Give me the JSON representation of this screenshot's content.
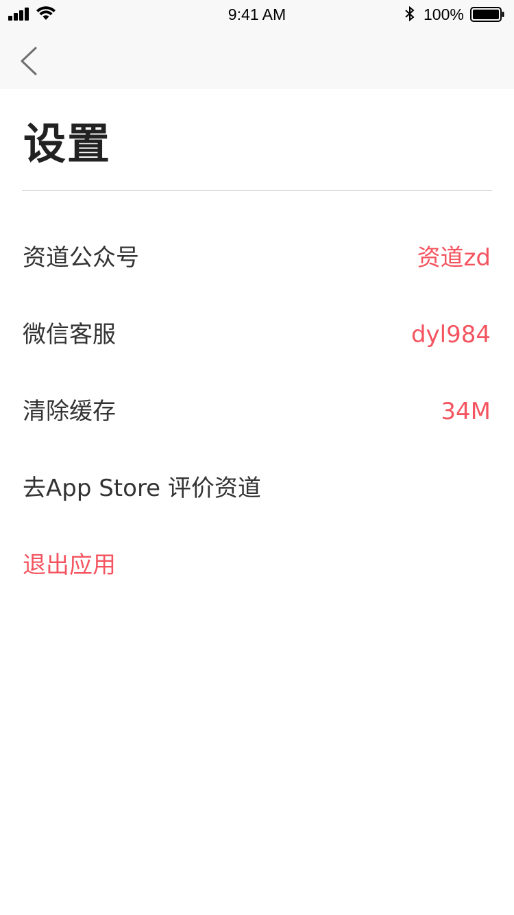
{
  "status_bar": {
    "time": "9:41 AM",
    "battery_percent": "100%"
  },
  "nav": {
    "back_icon": "chevron-left-icon"
  },
  "page": {
    "title": "设置"
  },
  "settings": [
    {
      "label": "资道公众号",
      "value": "资道zd"
    },
    {
      "label": "微信客服",
      "value": "dyl984"
    },
    {
      "label": "清除缓存",
      "value": "34M"
    },
    {
      "label": "去App Store 评价资道",
      "value": ""
    },
    {
      "label": "退出应用",
      "value": ""
    }
  ],
  "colors": {
    "accent": "#f4545f",
    "text": "#333333",
    "nav_background": "#f8f8f8"
  }
}
